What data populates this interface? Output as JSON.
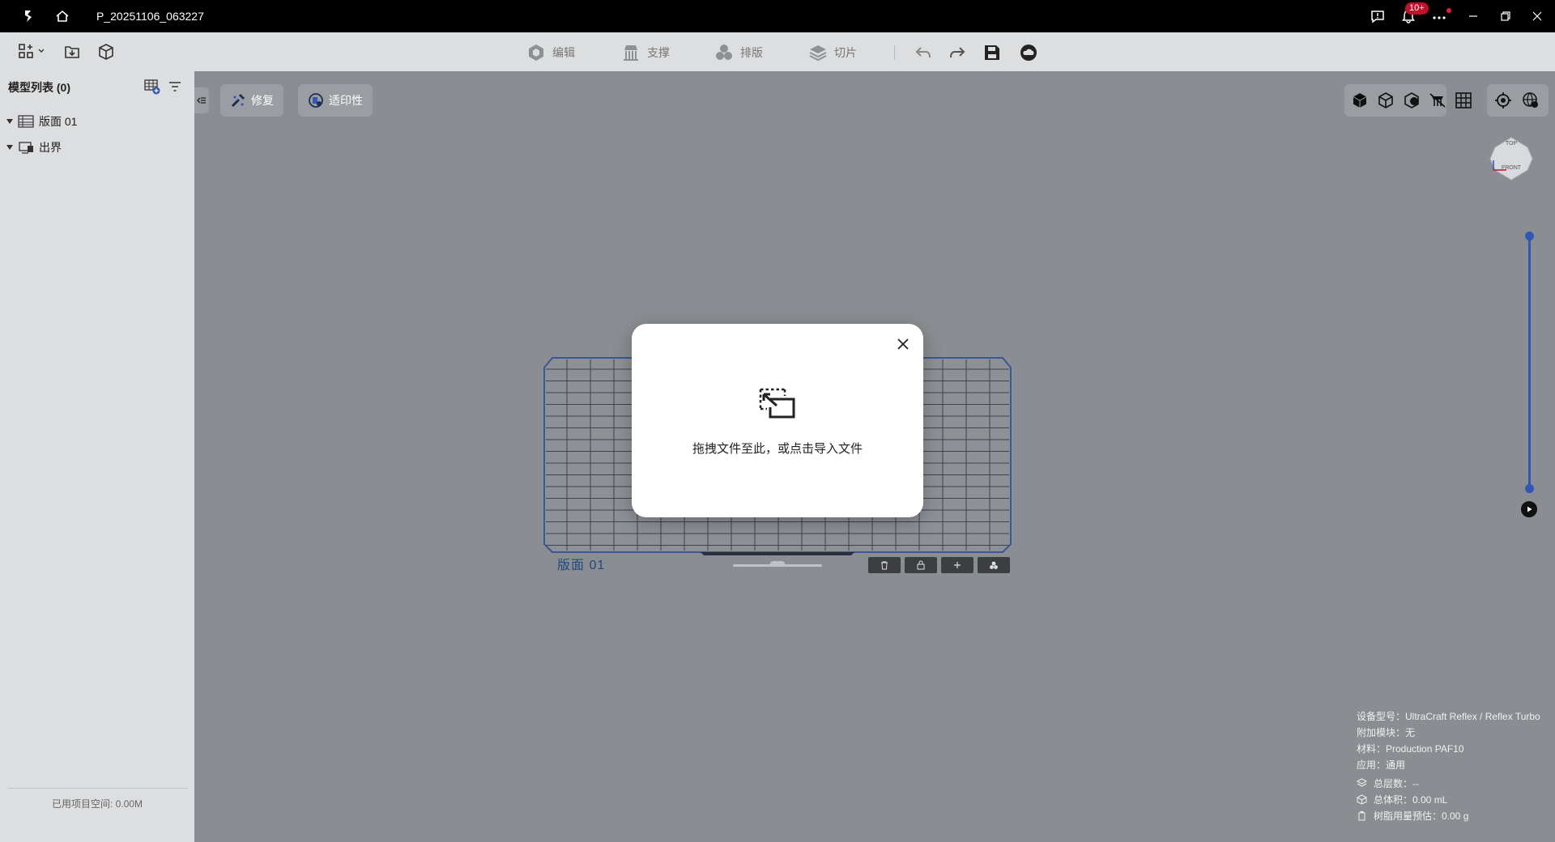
{
  "window": {
    "title": "P_20251106_063227",
    "notification_badge": "10+"
  },
  "toolbar": {
    "modes": [
      {
        "label": "编辑",
        "icon": "edit-cube-icon"
      },
      {
        "label": "支撑",
        "icon": "support-icon"
      },
      {
        "label": "排版",
        "icon": "layout-icon"
      },
      {
        "label": "切片",
        "icon": "slice-layers-icon"
      }
    ]
  },
  "sidebar": {
    "title": "模型列表 (0)",
    "tree": [
      {
        "label": "版面 01",
        "icon": "plate-grid-icon"
      },
      {
        "label": "出界",
        "icon": "out-of-bounds-icon"
      }
    ],
    "footer": "已用项目空间: 0.00M"
  },
  "viewport": {
    "repair_label": "修复",
    "printability_label": "适印性",
    "plate_label": "版面 01",
    "view_cube": {
      "top": "TOP",
      "front": "FRONT"
    }
  },
  "dialog": {
    "message": "拖拽文件至此，或点击导入文件"
  },
  "info": {
    "device": "设备型号：UltraCraft Reflex / Reflex Turbo",
    "addon": "附加模块：无",
    "material": "材料：Production PAF10",
    "application": "应用：通用",
    "layers": "总层数：--",
    "volume": "总体积：0.00 mL",
    "resin": "树脂用量预估：0.00 g"
  },
  "colors": {
    "accent": "#2f57b8",
    "badge": "#c0102a"
  }
}
